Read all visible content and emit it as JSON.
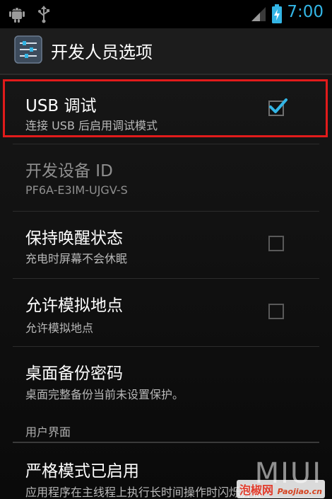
{
  "status_bar": {
    "time": "7:00",
    "icons": [
      "android-debug-icon",
      "usb-icon",
      "signal-icon",
      "battery-charging-icon"
    ]
  },
  "action_bar": {
    "title": "开发人员选项",
    "icon": "settings-sliders-icon"
  },
  "settings": [
    {
      "title": "USB 调试",
      "summary": "连接 USB 后启用调试模式",
      "checked": true,
      "enabled": true
    },
    {
      "title": "开发设备 ID",
      "summary": "PF6A-E3IM-UJGV-S",
      "enabled": false
    },
    {
      "title": "保持唤醒状态",
      "summary": "充电时屏幕不会休眠",
      "checked": false,
      "enabled": true
    },
    {
      "title": "允许模拟地点",
      "summary": "允许模拟地点",
      "checked": false,
      "enabled": true
    },
    {
      "title": "桌面备份密码",
      "summary": "桌面完整备份当前未设置保护。",
      "enabled": true
    }
  ],
  "section": {
    "header": "用户界面",
    "items": [
      {
        "title": "严格模式已启用",
        "summary": "应用程序在主线程上执行长时间操作时闪烁屏幕"
      }
    ]
  },
  "watermark": {
    "brand": "MIUI",
    "site": "泡椒网",
    "url": "Paojiao.cn"
  },
  "colors": {
    "accent": "#33b5e5",
    "highlight": "#e11b1b",
    "background": "#0b0b0b"
  }
}
